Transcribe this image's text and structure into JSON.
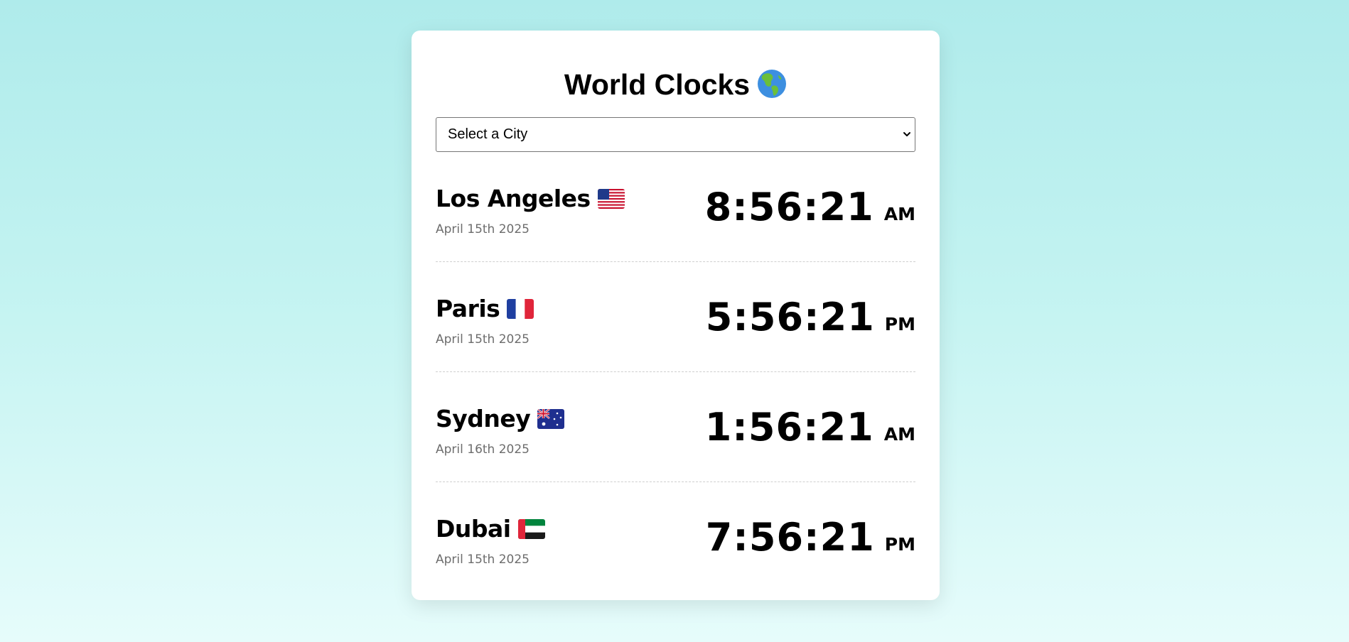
{
  "title": "World Clocks",
  "title_icon": "globe-americas-icon",
  "city_select": {
    "selected": "Select a City"
  },
  "clocks": [
    {
      "city": "Los Angeles",
      "flag": "flag-us-icon",
      "date": "April 15th 2025",
      "time": "8:56:21",
      "ampm": "AM"
    },
    {
      "city": "Paris",
      "flag": "flag-fr-icon",
      "date": "April 15th 2025",
      "time": "5:56:21",
      "ampm": "PM"
    },
    {
      "city": "Sydney",
      "flag": "flag-au-icon",
      "date": "April 16th 2025",
      "time": "1:56:21",
      "ampm": "AM"
    },
    {
      "city": "Dubai",
      "flag": "flag-ae-icon",
      "date": "April 15th 2025",
      "time": "7:56:21",
      "ampm": "PM"
    }
  ],
  "colors": {
    "background_top": "#afebeb",
    "background_bottom": "#e6fcfb",
    "card": "#ffffff",
    "date_text": "#6d6d6d",
    "divider": "#cfcfcf"
  }
}
